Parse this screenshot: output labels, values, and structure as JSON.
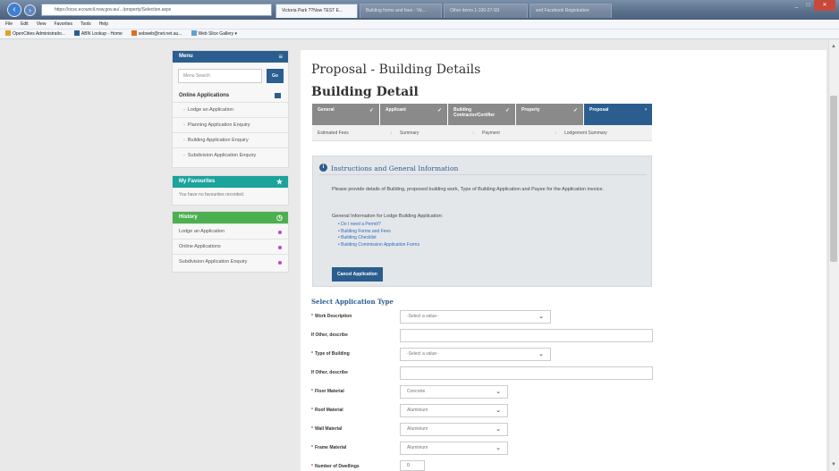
{
  "browser": {
    "address": "https://ocsc.ecouncil.nsw.gov.au/.../property/Selection.aspx",
    "active_tab": "Victoria Park ??Now TEST E...",
    "tabs": [
      "Building forms and fees - Vic...",
      "Other items 1-100-27-S9",
      "wrd Facebook Registration"
    ],
    "menu": [
      "File",
      "Edit",
      "View",
      "Favorites",
      "Tools",
      "Help"
    ],
    "favorites": [
      "OpenCities Administratio...",
      "ABN Lookup - Home",
      "sebweb@net.net.au...",
      "Web Slice Gallery"
    ]
  },
  "sidebar": {
    "menu_title": "Menu",
    "search_placeholder": "Menu Search",
    "go_label": "Go",
    "section_title": "Online Applications",
    "items": [
      {
        "label": "Lodge an Application"
      },
      {
        "label": "Planning Application Enquiry"
      },
      {
        "label": "Building Application Enquiry"
      },
      {
        "label": "Subdivision Application Enquiry"
      }
    ],
    "favourites_title": "My Favourites",
    "favourites_text": "You have no favourites recorded.",
    "history_title": "History",
    "history": [
      {
        "label": "Lodge an Application"
      },
      {
        "label": "Online Applications"
      },
      {
        "label": "Subdivision Application Enquiry"
      }
    ]
  },
  "main": {
    "page_title": "Proposal - Building Details",
    "sub_title": "Building Detail",
    "steps": [
      {
        "label": "General",
        "done": true
      },
      {
        "label": "Applicant",
        "done": true
      },
      {
        "label": "Building Contractor/Certifier",
        "done": true
      },
      {
        "label": "Property",
        "done": true
      },
      {
        "label": "Proposal",
        "done": false
      }
    ],
    "substeps": [
      "Estimated Fees",
      "Summary",
      "Payment",
      "Lodgement Summary"
    ],
    "info": {
      "title": "Instructions and General Information",
      "paragraph": "Please provide details of Building, proposed building work, Type of Building Application and Payee for the Application invoice.",
      "general": "General Information for Lodge Building Application:",
      "links": [
        "Do I need a Permit?",
        "Building Forms and Fees",
        "Building Checklist",
        "Building Commission Application Forms"
      ],
      "cancel_label": "Cancel Application"
    },
    "select_heading": "Select Application Type",
    "fields": [
      {
        "label": "Work Description",
        "value": "-Select a value-"
      },
      {
        "label": "If Other, describe"
      },
      {
        "label": "Type of Building",
        "value": "-Select a value-"
      },
      {
        "label": "If Other, describe"
      },
      {
        "label": "Floor Material",
        "value": "Concrete"
      },
      {
        "label": "Roof Material",
        "value": "Aluminium"
      },
      {
        "label": "Wall Material",
        "value": "Aluminium"
      },
      {
        "label": "Frame Material",
        "value": "Aluminium"
      },
      {
        "label": "Number of Dwellings",
        "value": "0"
      }
    ]
  }
}
